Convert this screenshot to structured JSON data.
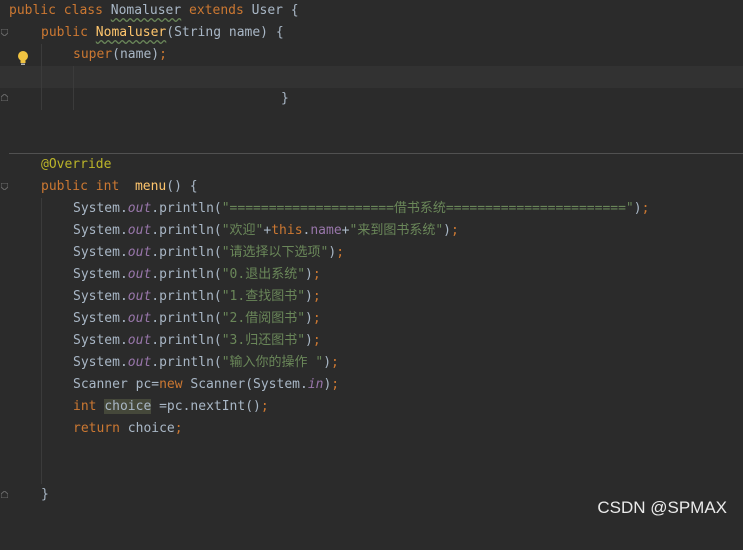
{
  "code_lines": {
    "l1": {
      "kw1": "public",
      "kw2": "class",
      "cls": "Nomaluser",
      "kw3": "extends",
      "parent": "User",
      "brace": " {"
    },
    "l2": {
      "kw1": "public",
      "name": "Nomaluser",
      "params": "(String name) {"
    },
    "l3": {
      "kw": "super",
      "rest": "(name)",
      "semi": ";"
    },
    "l5": {
      "brace": "}"
    },
    "l7": {
      "ann": "@Override"
    },
    "l8": {
      "kw1": "public",
      "kw2": "int",
      "name": "menu",
      "rest": "() {"
    },
    "println": [
      {
        "pre": "System.",
        "out": "out",
        "mid": ".println(",
        "str": "\"=====================借书系统=======================\"",
        "end": ")",
        "semi": ";"
      },
      {
        "pre": "System.",
        "out": "out",
        "mid": ".println(",
        "str": "\"欢迎\"",
        "plus1": "+",
        "this": "this",
        "dot": ".",
        "field": "name",
        "plus2": "+",
        "str2": "\"来到图书系统\"",
        "end": ")",
        "semi": ";"
      },
      {
        "pre": "System.",
        "out": "out",
        "mid": ".println(",
        "str": "\"请选择以下选项\"",
        "end": ")",
        "semi": ";"
      },
      {
        "pre": "System.",
        "out": "out",
        "mid": ".println(",
        "str": "\"0.退出系统\"",
        "end": ")",
        "semi": ";"
      },
      {
        "pre": "System.",
        "out": "out",
        "mid": ".println(",
        "str": "\"1.查找图书\"",
        "end": ")",
        "semi": ";"
      },
      {
        "pre": "System.",
        "out": "out",
        "mid": ".println(",
        "str": "\"2.借阅图书\"",
        "end": ")",
        "semi": ";"
      },
      {
        "pre": "System.",
        "out": "out",
        "mid": ".println(",
        "str": "\"3.归还图书\"",
        "end": ")",
        "semi": ";"
      },
      {
        "pre": "System.",
        "out": "out",
        "mid": ".println(",
        "str": "\"输入你的操作 \"",
        "end": ")",
        "semi": ";"
      }
    ],
    "scanner": {
      "a": "Scanner pc=",
      "new": "new",
      "b": " Scanner(System.",
      "in": "in",
      "c": ")",
      "semi": ";"
    },
    "choice": {
      "kw": "int",
      "var": "choice",
      "rest": " =pc.nextInt()",
      "semi": ";"
    },
    "ret": {
      "kw": "return",
      "rest": " choice",
      "semi": ";"
    },
    "close": {
      "brace": "}"
    }
  },
  "watermark": "CSDN @SPMAX",
  "icons": {
    "bulb": "lightbulb-icon",
    "fold": "fold-marker-icon"
  },
  "colors": {
    "background": "#2b2b2b",
    "keyword": "#cc7832",
    "string": "#6a8759",
    "method": "#ffc66d",
    "field": "#9876aa",
    "annotation": "#bbb529",
    "text": "#a9b7c6"
  }
}
